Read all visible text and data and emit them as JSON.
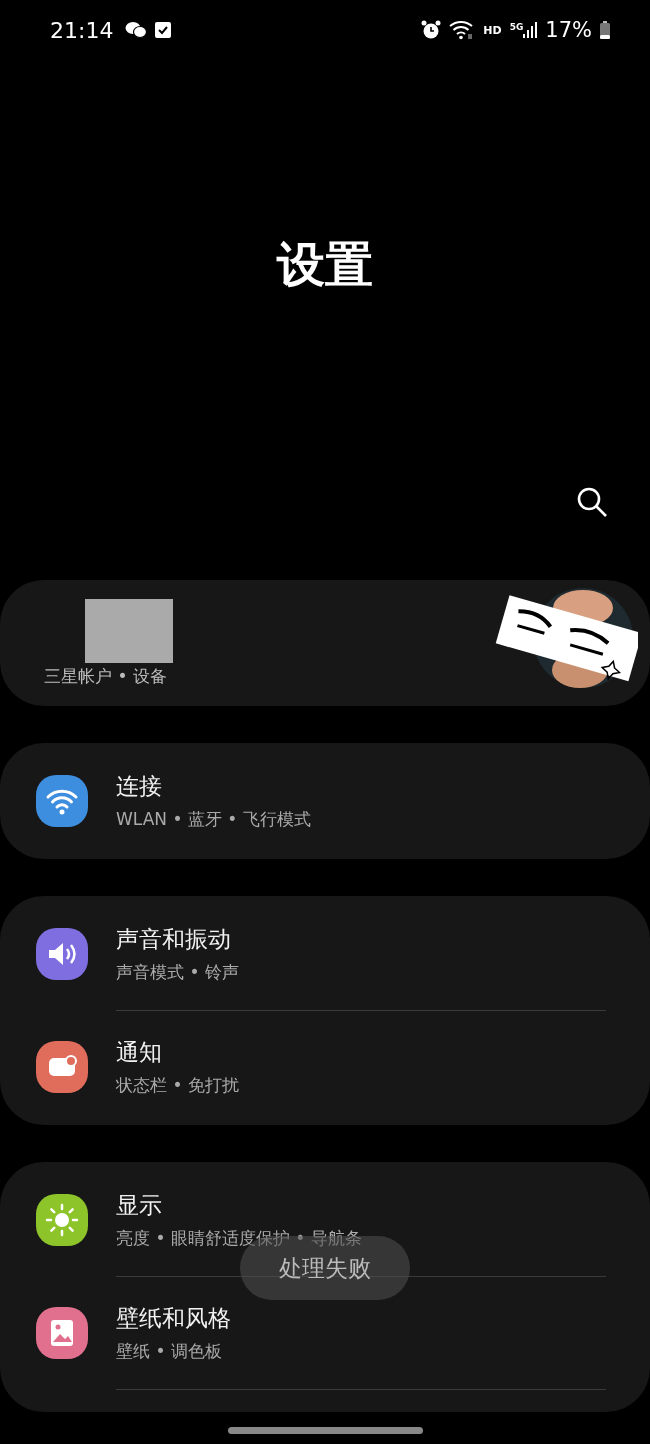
{
  "status_bar": {
    "time": "21:14",
    "battery": "17%",
    "network": "5G",
    "hd": "HD"
  },
  "title": "设置",
  "account": {
    "subtitle": "三星帐户 • 设备"
  },
  "groups": [
    {
      "items": [
        {
          "kind": "wifi",
          "color": "#3e8ee0",
          "title": "连接",
          "subtitle": "WLAN • 蓝牙 • 飞行模式"
        }
      ]
    },
    {
      "items": [
        {
          "kind": "sound",
          "color": "#7f6ee0",
          "title": "声音和振动",
          "subtitle": "声音模式 • 铃声"
        },
        {
          "kind": "notification",
          "color": "#e06d5c",
          "title": "通知",
          "subtitle": "状态栏 • 免打扰"
        }
      ]
    },
    {
      "items": [
        {
          "kind": "display",
          "color": "#8cc42a",
          "title": "显示",
          "subtitle": "亮度 • 眼睛舒适度保护 • 导航条"
        },
        {
          "kind": "wallpaper",
          "color": "#e0708e",
          "title": "壁纸和风格",
          "subtitle": "壁纸 • 调色板"
        }
      ]
    }
  ],
  "toast": "处理失败"
}
